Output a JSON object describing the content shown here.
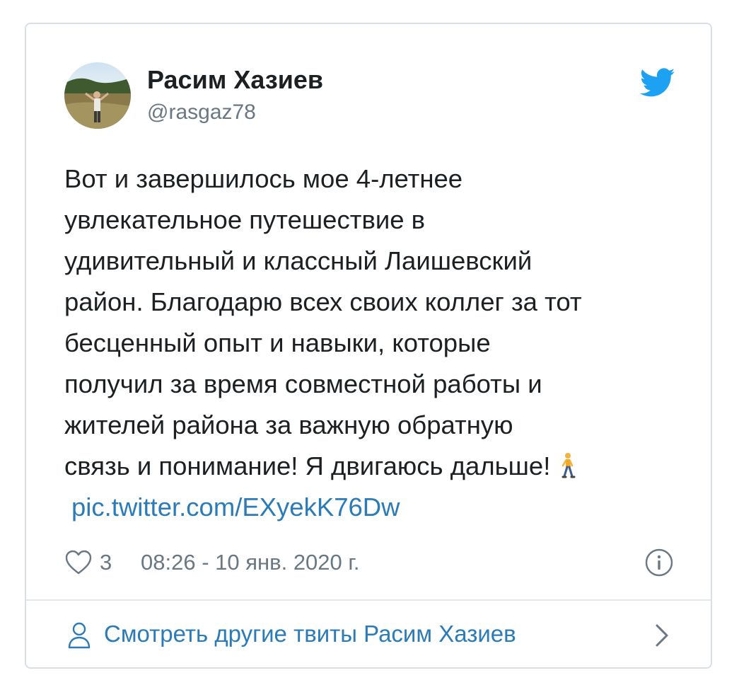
{
  "author": {
    "name": "Расим Хазиев",
    "handle": "@rasgaz78",
    "avatar_icon": "profile-photo"
  },
  "tweet": {
    "lines": [
      "Вот и завершилось мое 4-летнее",
      "увлекательное путешествие в",
      "удивительный и классный Лаишевский",
      "район. Благодарю всех своих коллег за тот",
      "бесценный опыт и навыки, которые",
      "получил за время совместной работы и",
      "жителей района за важную обратную",
      "связь и понимание! Я двигаюсь дальше!"
    ],
    "emoji": "person-walking-icon",
    "link": "pic.twitter.com/EXyekK76Dw"
  },
  "meta": {
    "like_count": "3",
    "timestamp": "08:26 - 10 янв. 2020 г."
  },
  "footer": {
    "label": "Смотреть другие твиты Расим Хазиев"
  },
  "colors": {
    "brand": "#1da1f2",
    "link": "#2b7bb9",
    "text": "#1c2022",
    "muted": "#697882",
    "border": "#d9dfe3"
  }
}
